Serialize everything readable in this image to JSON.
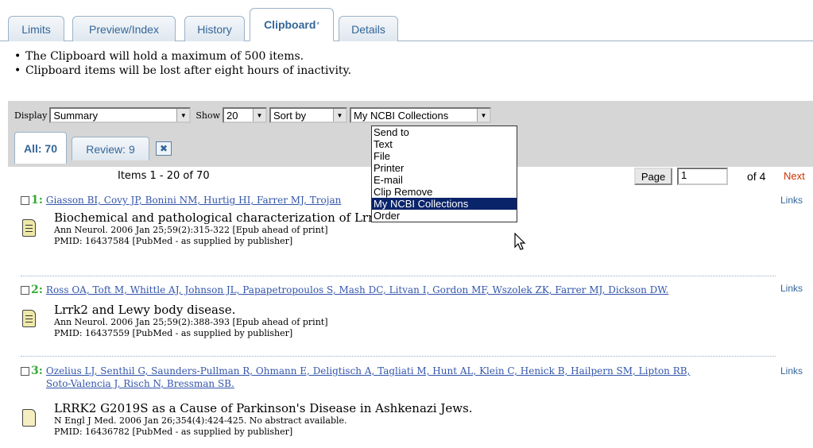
{
  "tabs": [
    {
      "label": "Limits"
    },
    {
      "label": "Preview/Index"
    },
    {
      "label": "History"
    },
    {
      "label": "Clipboard"
    },
    {
      "label": "Details"
    }
  ],
  "notes": [
    "The Clipboard will hold a maximum of 500 items.",
    "Clipboard items will be lost after eight hours of inactivity."
  ],
  "toolbar": {
    "display_label": "Display",
    "display_value": "Summary",
    "show_label": "Show",
    "show_value": "20",
    "sort_value": "Sort by",
    "send_value": "My NCBI Collections"
  },
  "subtabs": {
    "all": "All: 70",
    "review": "Review: 9"
  },
  "paging": {
    "items": "Items 1 - 20 of 70",
    "page_button": "Page",
    "page_value": "1",
    "of_pages": "of 4",
    "next": "Next"
  },
  "dropdown": {
    "items": [
      "Send to",
      "Text",
      "File",
      "Printer",
      "E-mail",
      "Clip Remove",
      "My NCBI Collections",
      "Order"
    ],
    "selected": "My NCBI Collections"
  },
  "records": [
    {
      "num": "1:",
      "authors": "Giasson BI, Covy JP, Bonini NM, Hurtig HI, Farrer MJ, Trojan",
      "title": "Biochemical and pathological characterization of Lrrk2",
      "source": "Ann Neurol. 2006 Jan 25;59(2):315-322 [Epub ahead of print]",
      "pmid": "PMID: 16437584 [PubMed - as supplied by publisher]",
      "links": "Links"
    },
    {
      "num": "2:",
      "authors": "Ross OA, Toft M, Whittle AJ, Johnson JL, Papapetropoulos S, Mash DC, Litvan I, Gordon MF, Wszolek ZK, Farrer MJ, Dickson DW.",
      "title": "Lrrk2 and Lewy body disease.",
      "source": "Ann Neurol. 2006 Jan 25;59(2):388-393 [Epub ahead of print]",
      "pmid": "PMID: 16437559 [PubMed - as supplied by publisher]",
      "links": "Links"
    },
    {
      "num": "3:",
      "authors": "Ozelius LJ, Senthil G, Saunders-Pullman R, Ohmann E, Deligtisch A, Tagliati M, Hunt AL, Klein C, Henick B, Hailpern SM, Lipton RB,",
      "authors2": "Soto-Valencia J, Risch N, Bressman SB.",
      "title": "LRRK2 G2019S as a Cause of Parkinson's Disease in Ashkenazi Jews.",
      "source": "N Engl J Med. 2006 Jan 26;354(4):424-425. No abstract available.",
      "pmid": "PMID: 16436782 [PubMed - as supplied by publisher]",
      "links": "Links"
    }
  ]
}
